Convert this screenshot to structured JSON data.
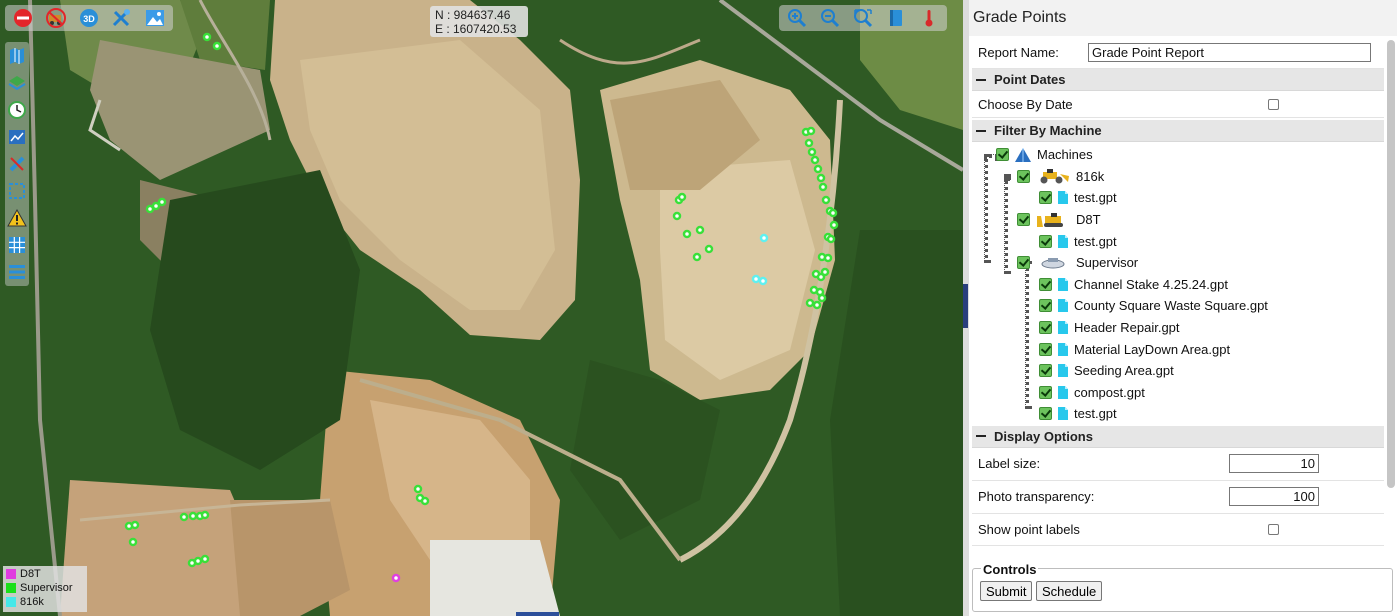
{
  "map": {
    "coords": {
      "n": "N : 984637.46",
      "e": "E : 1607420.53"
    },
    "toolbar_left": [
      {
        "icon": "stop-icon"
      },
      {
        "icon": "no-truck-icon"
      },
      {
        "icon": "3d-icon",
        "label": "3D"
      },
      {
        "icon": "tools-icon"
      },
      {
        "icon": "image-icon"
      }
    ],
    "toolbar_right": [
      {
        "icon": "zoom-in-icon"
      },
      {
        "icon": "zoom-out-icon"
      },
      {
        "icon": "zoom-extent-icon"
      },
      {
        "icon": "book-icon"
      },
      {
        "icon": "thermometer-icon"
      }
    ],
    "left_tools": [
      {
        "icon": "map-icon"
      },
      {
        "icon": "layers-icon"
      },
      {
        "icon": "clock-icon"
      },
      {
        "icon": "chart-icon"
      },
      {
        "icon": "measure-icon"
      },
      {
        "icon": "select-icon"
      },
      {
        "icon": "warning-icon"
      },
      {
        "icon": "grid-icon"
      },
      {
        "icon": "list-icon"
      }
    ],
    "legend": [
      {
        "label": "D8T",
        "color": "#e03ce0"
      },
      {
        "label": "Supervisor",
        "color": "#19e019"
      },
      {
        "label": "816k",
        "color": "#46e8e8"
      }
    ],
    "point_colors": {
      "green": "#39e039",
      "cyan": "#5ff0f0",
      "magenta": "#e040e0"
    }
  },
  "panel": {
    "title": "Grade Points",
    "report_name_label": "Report Name:",
    "report_name_value": "Grade Point Report",
    "section_point_dates": "Point Dates",
    "choose_by_date_label": "Choose By Date",
    "section_filter": "Filter By Machine",
    "tree": {
      "root": "Machines",
      "machines": [
        {
          "name": "816k",
          "icon": "compactor-icon",
          "files": [
            "test.gpt"
          ]
        },
        {
          "name": "D8T",
          "icon": "dozer-icon",
          "files": [
            "test.gpt"
          ]
        },
        {
          "name": "Supervisor",
          "icon": "rover-icon",
          "files": [
            "Channel Stake 4.25.24.gpt",
            "County Square Waste Square.gpt",
            "Header Repair.gpt",
            "Material LayDown Area.gpt",
            "Seeding Area.gpt",
            "compost.gpt",
            "test.gpt"
          ]
        }
      ]
    },
    "section_display": "Display Options",
    "label_size_label": "Label size:",
    "label_size_value": "10",
    "photo_transparency_label": "Photo transparency:",
    "photo_transparency_value": "100",
    "show_labels_label": "Show point labels",
    "controls_legend": "Controls",
    "submit_label": "Submit",
    "schedule_label": "Schedule"
  }
}
